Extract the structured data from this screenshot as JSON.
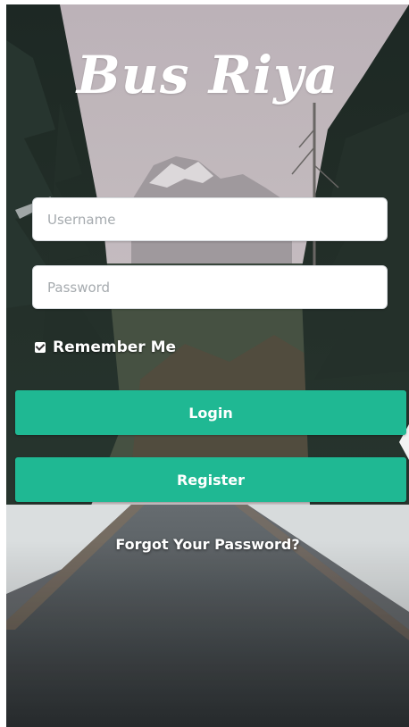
{
  "app": {
    "title": "Bus Riya"
  },
  "form": {
    "username_placeholder": "Username",
    "username_value": "",
    "password_placeholder": "Password",
    "password_value": "",
    "remember_label": "Remember Me",
    "remember_checked": true
  },
  "actions": {
    "login_label": "Login",
    "register_label": "Register",
    "forgot_label": "Forgot Your Password?"
  },
  "colors": {
    "accent": "#1fb893",
    "text_on_accent": "#ffffff"
  },
  "icons": {
    "checkbox": "checkbox-checked-icon"
  }
}
